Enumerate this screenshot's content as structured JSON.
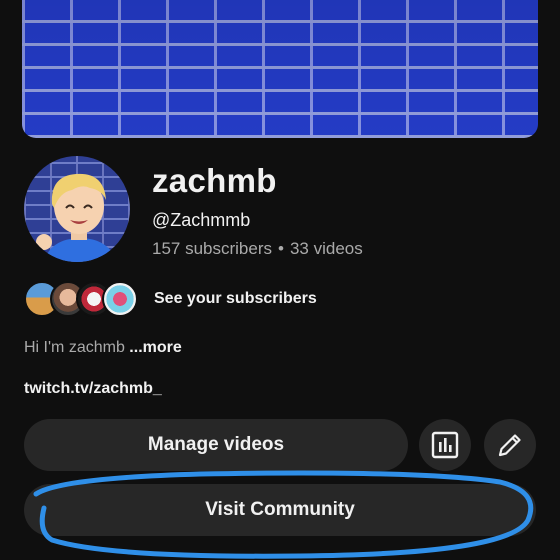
{
  "channel": {
    "name": "zachmb",
    "handle": "@Zachmmb",
    "subscribers": "157 subscribers",
    "separator": "•",
    "videos": "33 videos"
  },
  "subscribers_row": {
    "label": "See your subscribers"
  },
  "bio": {
    "text": "Hi I'm zachmb ",
    "more": "...more"
  },
  "link": {
    "text": "twitch.tv/zachmb_"
  },
  "actions": {
    "manage_label": "Manage videos",
    "analytics_icon": "analytics-icon",
    "edit_icon": "pencil-icon",
    "community_label": "Visit Community"
  },
  "colors": {
    "background": "#0f0f0f",
    "button": "#272727",
    "annotation": "#2f8fe8",
    "banner_brick": "#263fd0"
  }
}
